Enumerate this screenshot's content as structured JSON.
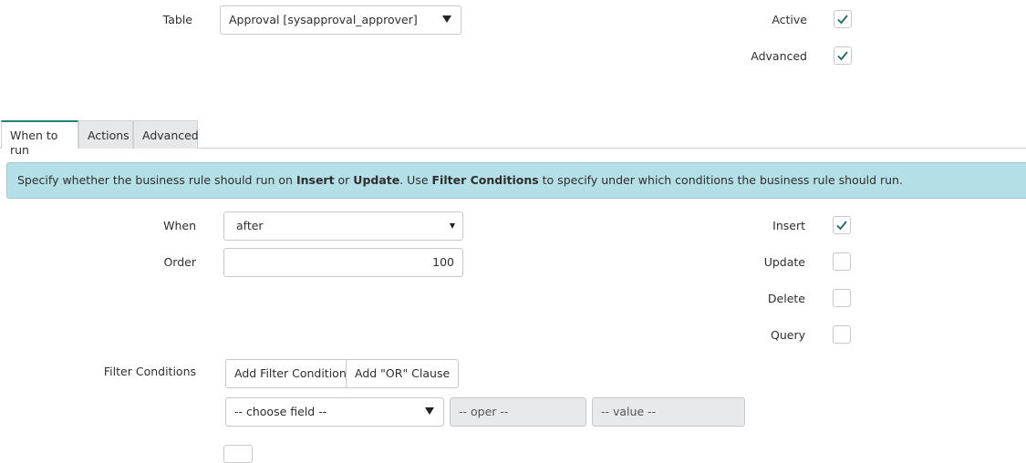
{
  "header": {
    "table_label": "Table",
    "table_value": "Approval [sysapproval_approver]",
    "active_label": "Active",
    "active_checked": true,
    "advanced_label": "Advanced",
    "advanced_checked": true
  },
  "tabs": [
    {
      "label": "When to run",
      "active": true
    },
    {
      "label": "Actions",
      "active": false
    },
    {
      "label": "Advanced",
      "active": false
    }
  ],
  "info": {
    "t1": "Specify whether the business rule should run on ",
    "b1": "Insert",
    "t2": " or ",
    "b2": "Update",
    "t3": ". Use ",
    "b3": "Filter Conditions",
    "t4": " to specify under which conditions the business rule should run."
  },
  "when": {
    "label": "When",
    "value": "after"
  },
  "order": {
    "label": "Order",
    "value": "100"
  },
  "operations": [
    {
      "label": "Insert",
      "checked": true
    },
    {
      "label": "Update",
      "checked": false
    },
    {
      "label": "Delete",
      "checked": false
    },
    {
      "label": "Query",
      "checked": false
    }
  ],
  "filter": {
    "label": "Filter Conditions",
    "add_condition": "Add Filter Condition",
    "add_or": "Add \"OR\" Clause",
    "field_placeholder": "-- choose field --",
    "oper_placeholder": "-- oper --",
    "value_placeholder": "-- value --"
  },
  "colors": {
    "accent": "#1f8476",
    "info_bg": "#b5dfe6",
    "check": "#1f6b5e"
  }
}
